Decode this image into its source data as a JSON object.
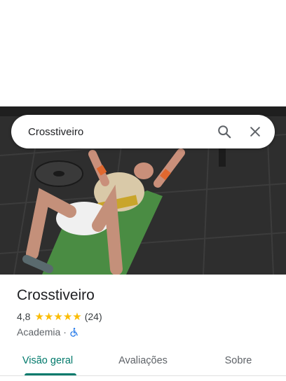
{
  "search": {
    "query": "Crosstiveiro"
  },
  "place": {
    "name": "Crosstiveiro",
    "rating": "4,8",
    "stars": 5,
    "review_count": "(24)",
    "category": "Academia",
    "separator": "·"
  },
  "tabs": [
    {
      "label": "Visão geral",
      "active": true
    },
    {
      "label": "Avaliações",
      "active": false
    },
    {
      "label": "Sobre",
      "active": false
    }
  ],
  "colors": {
    "accent": "#00796b",
    "star": "#fbbc04",
    "wheelchair": "#1a73e8"
  },
  "icons": [
    "search-icon",
    "close-icon",
    "star-icon",
    "wheelchair-icon"
  ]
}
